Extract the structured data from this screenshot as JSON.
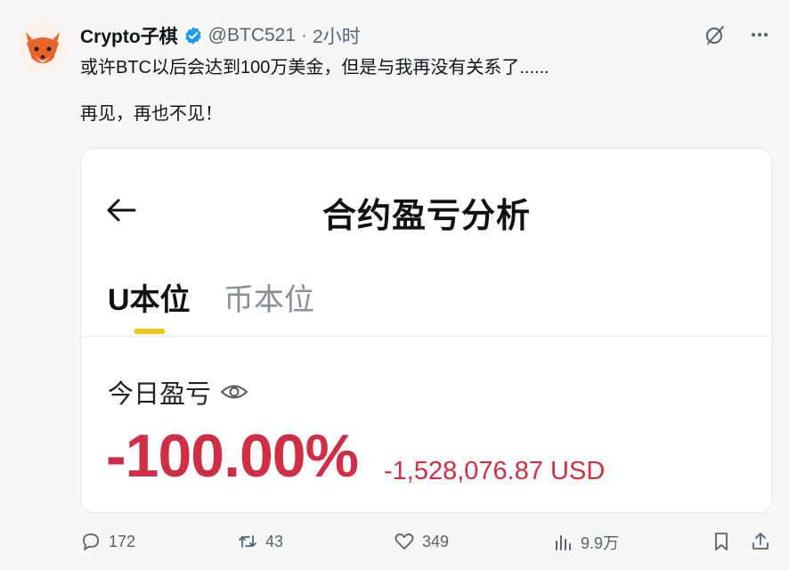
{
  "tweet": {
    "author_name": "Crypto子棋",
    "handle": "@BTC521",
    "separator": "·",
    "time": "2小时",
    "text_line1": "或许BTC以后会达到100万美金，但是与我再没有关系了......",
    "text_line2": "再见，再也不见！"
  },
  "card": {
    "title": "合约盈亏分析",
    "tabs": [
      {
        "label": "U本位",
        "active": true
      },
      {
        "label": "币本位",
        "active": false
      }
    ],
    "pnl_label": "今日盈亏",
    "pnl_percent": "-100.00%",
    "pnl_usd": "-1,528,076.87 USD"
  },
  "actions": {
    "replies": "172",
    "retweets": "43",
    "likes": "349",
    "views": "9.9万"
  },
  "colors": {
    "loss_red": "#cf2e45",
    "tab_accent": "#f0c419",
    "verified_blue": "#1d9bf0",
    "muted": "#536471"
  }
}
